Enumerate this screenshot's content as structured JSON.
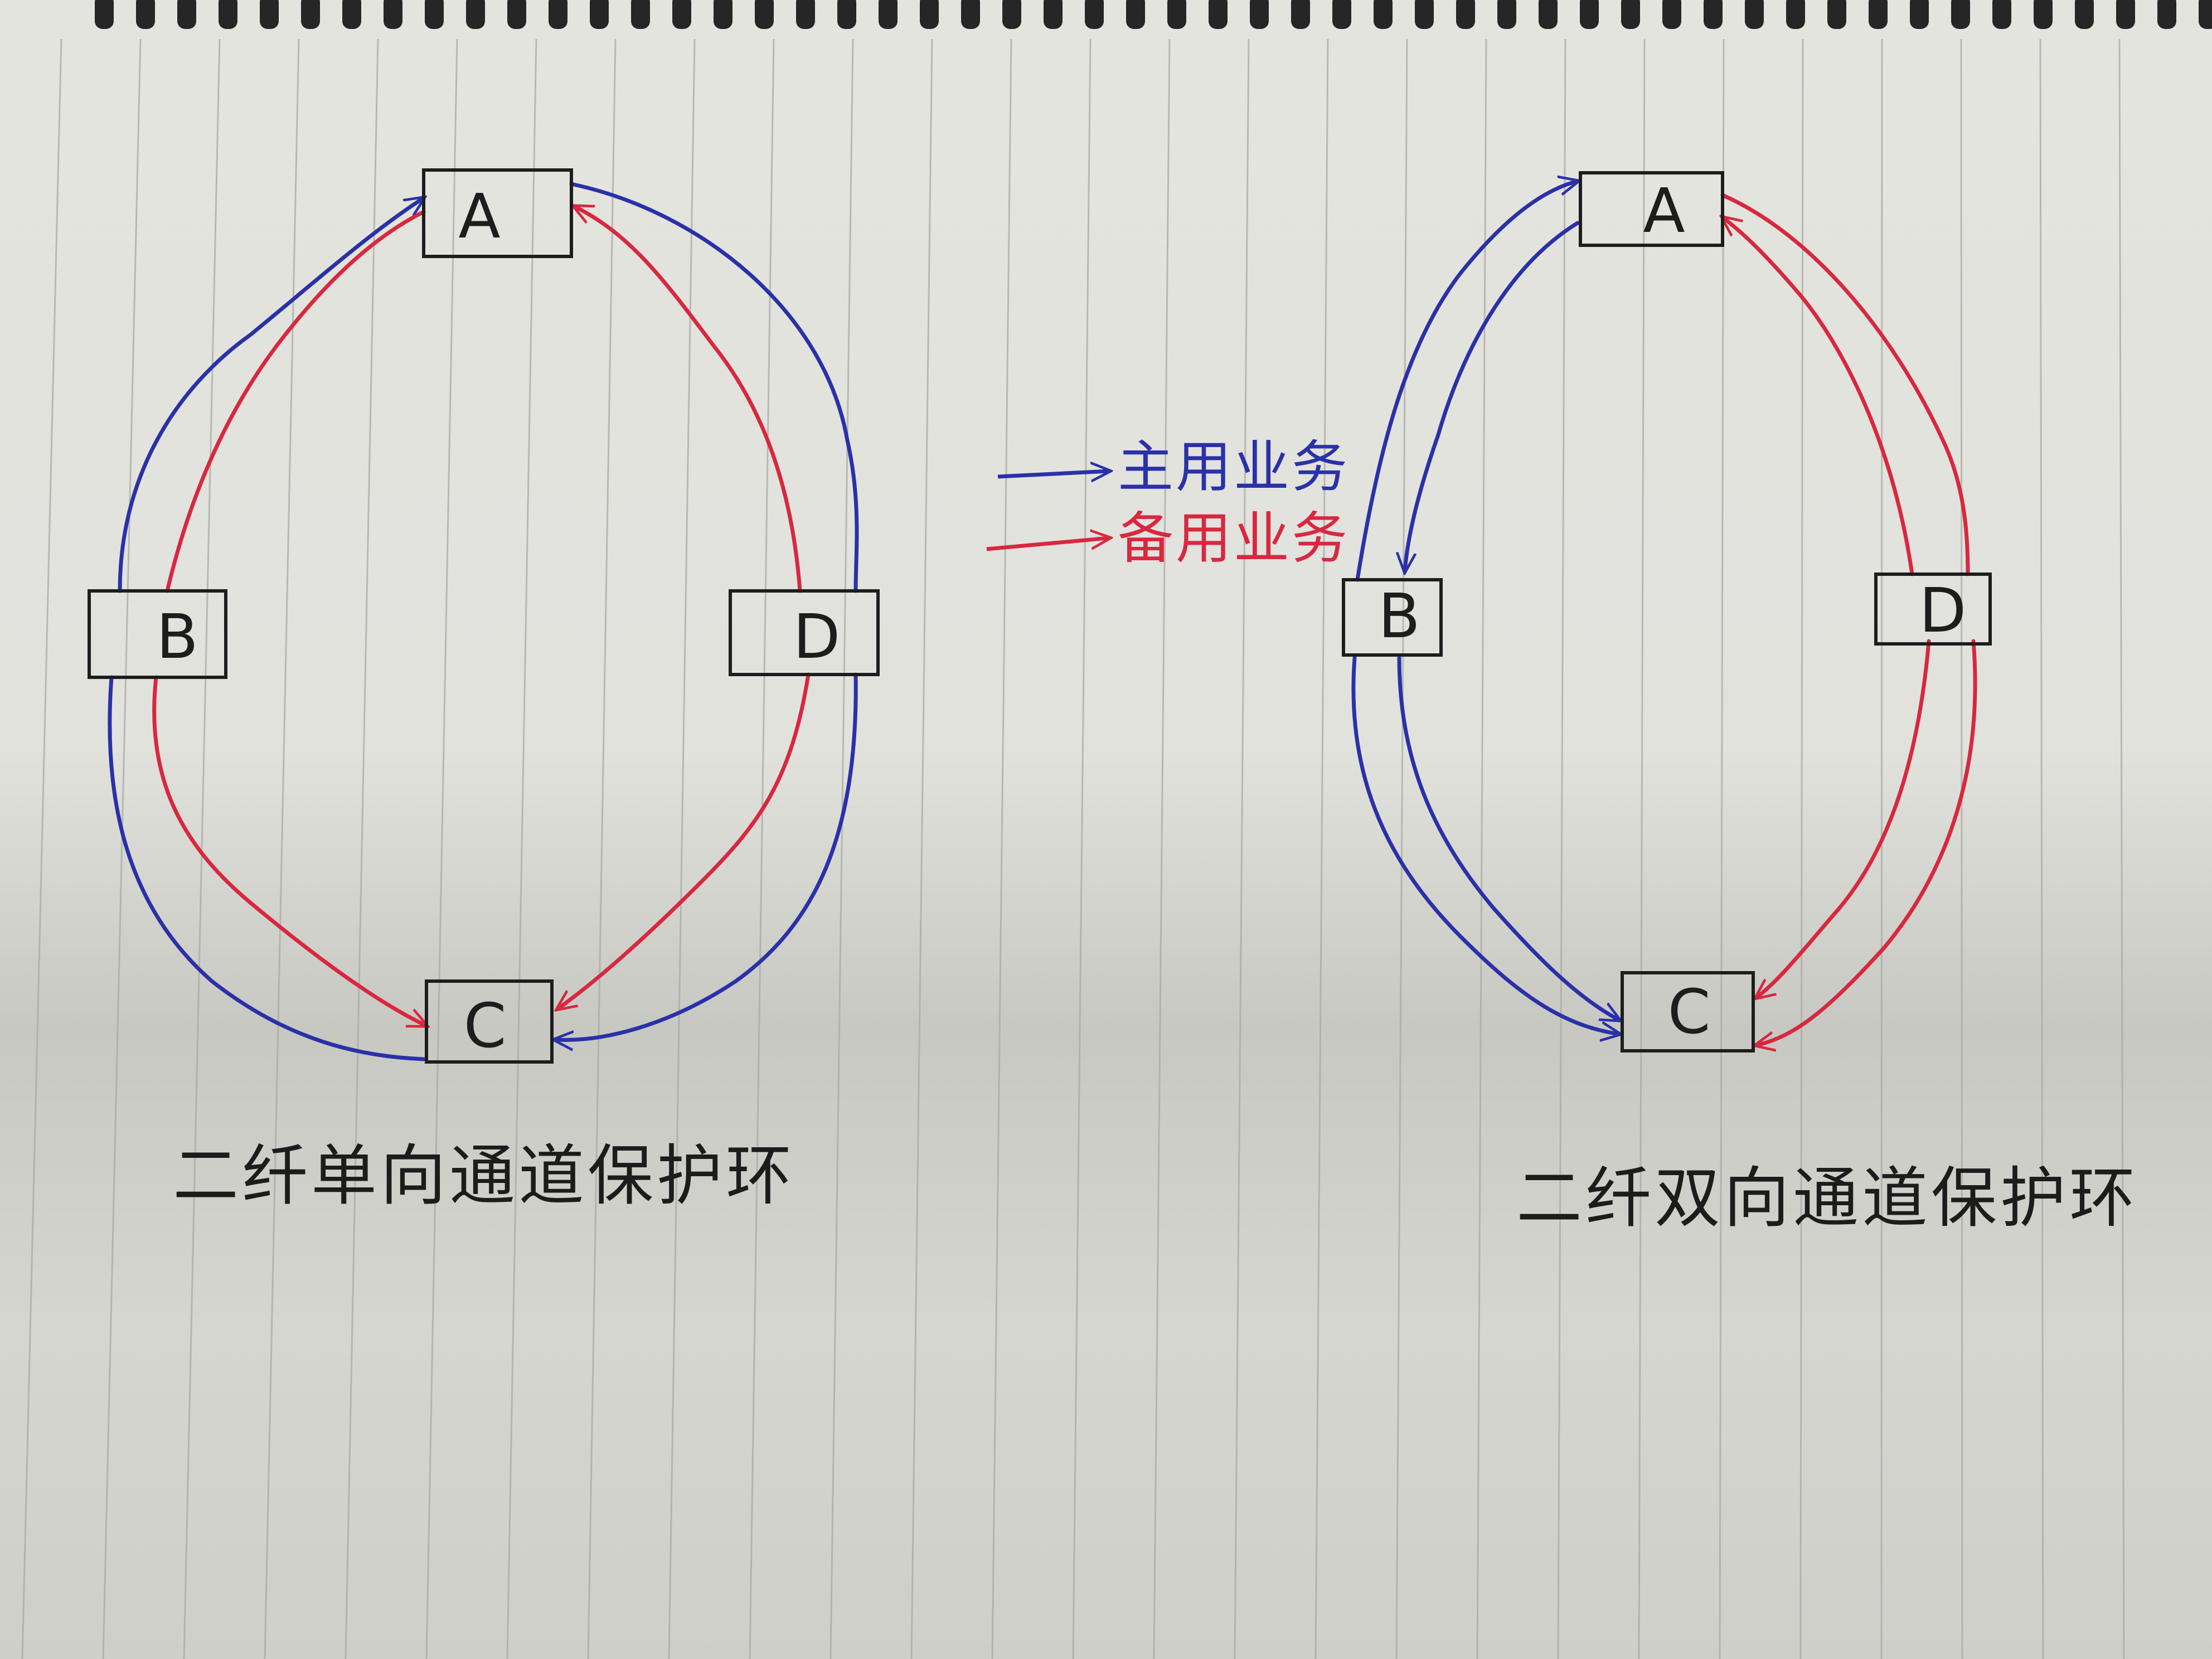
{
  "colors": {
    "primary": "#2a31a8",
    "backup": "#d8283f",
    "ink": "#1d1d1d",
    "paper": "#e3e3de",
    "rule": "#a9a9a6"
  },
  "legend": {
    "primary_label": "主用业务",
    "backup_label": "备用业务"
  },
  "left_ring": {
    "caption": "二纤单向通道保护环",
    "nodes": {
      "a": "A",
      "b": "B",
      "c": "C",
      "d": "D"
    }
  },
  "right_ring": {
    "caption": "二纤双向通道保护环",
    "nodes": {
      "a": "A",
      "b": "B",
      "c": "C",
      "d": "D"
    }
  }
}
